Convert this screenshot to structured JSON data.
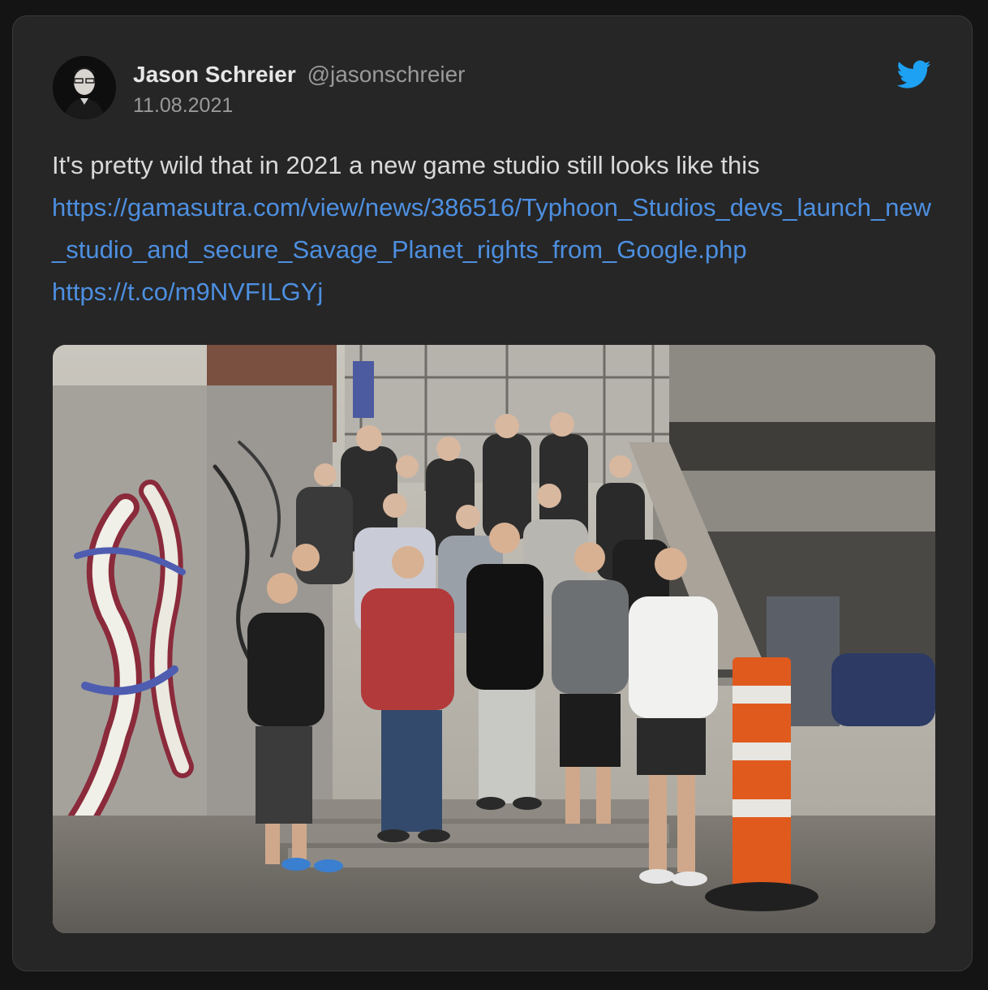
{
  "tweet": {
    "author_name": "Jason Schreier",
    "author_handle": "@jasonschreier",
    "date": "11.08.2021",
    "text": "It's pretty wild that in 2021 a new game studio still looks like this",
    "link_1": "https://gamasutra.com/view/news/386516/Typhoon_Studios_devs_launch_new_studio_and_secure_Savage_Planet_rights_from_Google.php",
    "link_2": "https://t.co/m9NVFILGYj"
  },
  "icons": {
    "brand": "twitter-bird-icon",
    "brand_color": "#1da1f2"
  },
  "colors": {
    "card_background": "#262626",
    "link": "#4d8fe0",
    "text": "#d9d9d9",
    "muted": "#9a9a9a"
  }
}
